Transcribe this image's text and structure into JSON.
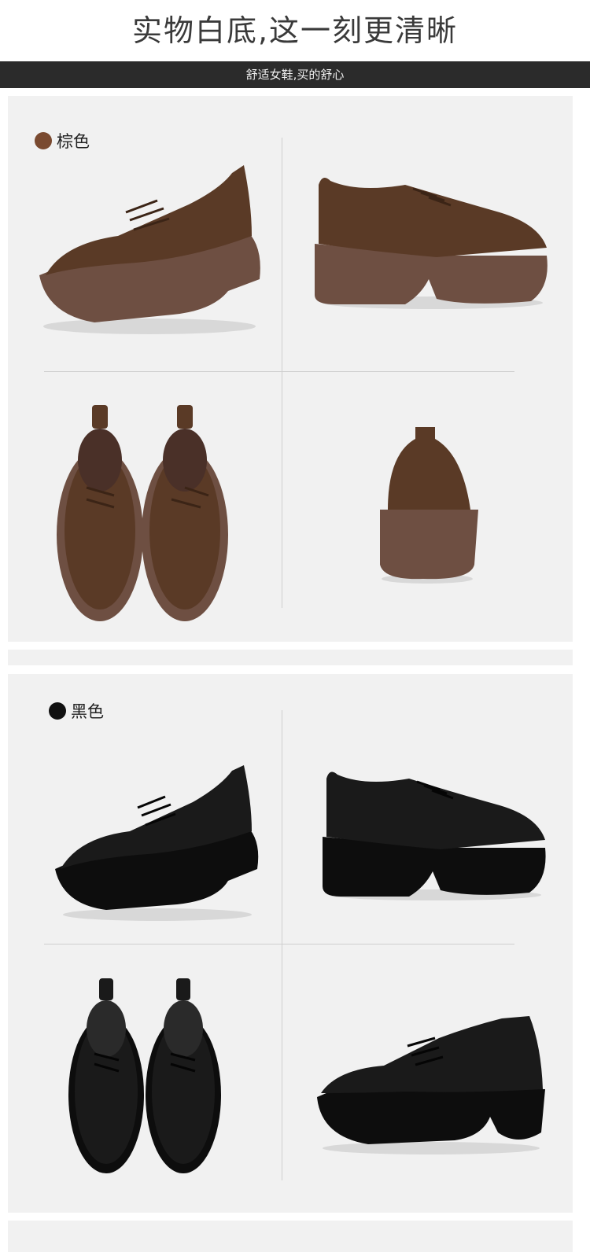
{
  "header": {
    "title": "实物白底,这一刻更清晰",
    "subtitle": "舒适女鞋,买的舒心"
  },
  "sections": [
    {
      "color_name": "棕色",
      "swatch_color": "#7a4a30",
      "upper_color": "#5a3a26",
      "sole_color": "#6e4f42",
      "lace_color": "#3b2416"
    },
    {
      "color_name": "黑色",
      "swatch_color": "#111111",
      "upper_color": "#1a1a1a",
      "sole_color": "#0d0d0d",
      "lace_color": "#050505"
    }
  ]
}
